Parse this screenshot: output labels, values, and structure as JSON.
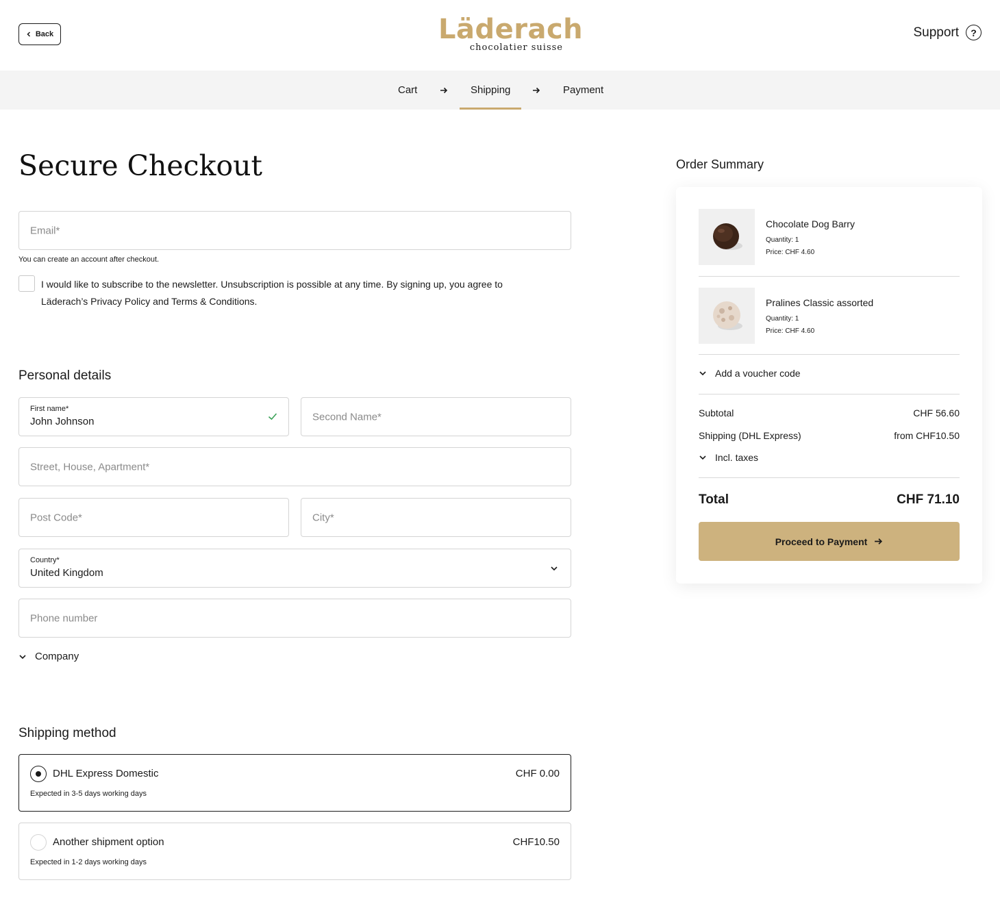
{
  "header": {
    "back_label": "Back",
    "logo_main": "Läderach",
    "logo_sub": "chocolatier suisse",
    "support_label": "Support",
    "support_icon": "question-circle-icon"
  },
  "steps": [
    {
      "label": "Cart",
      "active": false
    },
    {
      "label": "Shipping",
      "active": true
    },
    {
      "label": "Payment",
      "active": false
    }
  ],
  "checkout": {
    "title": "Secure Checkout",
    "email_placeholder": "Email*",
    "email_helper": "You can create an account after checkout.",
    "newsletter_line1": "I would like to subscribe to the newsletter. Unsubscription is possible at any time. By signing up, you agree to",
    "newsletter_line2": "Läderach’s Privacy Policy and Terms & Conditions.",
    "newsletter_checked": false
  },
  "personal": {
    "heading": "Personal details",
    "first_name_label": "First name*",
    "first_name_value": "John Johnson",
    "second_name_placeholder": "Second Name*",
    "street_placeholder": "Street, House, Apartment*",
    "postcode_placeholder": "Post Code*",
    "city_placeholder": "City*",
    "country_label": "Country*",
    "country_value": "United Kingdom",
    "phone_placeholder": "Phone number",
    "company_label": "Company"
  },
  "shipping": {
    "heading": "Shipping method",
    "options": [
      {
        "name": "DHL Express Domestic",
        "price": "CHF 0.00",
        "eta": "Expected in 3-5 days working days",
        "selected": true
      },
      {
        "name": "Another shipment option",
        "price": "CHF10.50",
        "eta": "Expected in 1-2 days working days",
        "selected": false
      }
    ]
  },
  "summary": {
    "heading": "Order Summary",
    "items": [
      {
        "name": "Chocolate Dog Barry",
        "qty": "Quantity: 1",
        "price": "Price: CHF 4.60"
      },
      {
        "name": "Pralines Classic assorted",
        "qty": "Quantity: 1",
        "price": "Price: CHF 4.60"
      }
    ],
    "voucher_label": "Add a voucher code",
    "subtotal_label": "Subtotal",
    "subtotal_value": "CHF 56.60",
    "shipping_label": "Shipping (DHL Express)",
    "shipping_value": "from CHF10.50",
    "taxes_label": "Incl. taxes",
    "total_label": "Total",
    "total_value": "CHF 71.10",
    "proceed_label": "Proceed to Payment"
  },
  "colors": {
    "accent": "#c9a96e",
    "button": "#cdb27e",
    "check": "#3aa157"
  }
}
